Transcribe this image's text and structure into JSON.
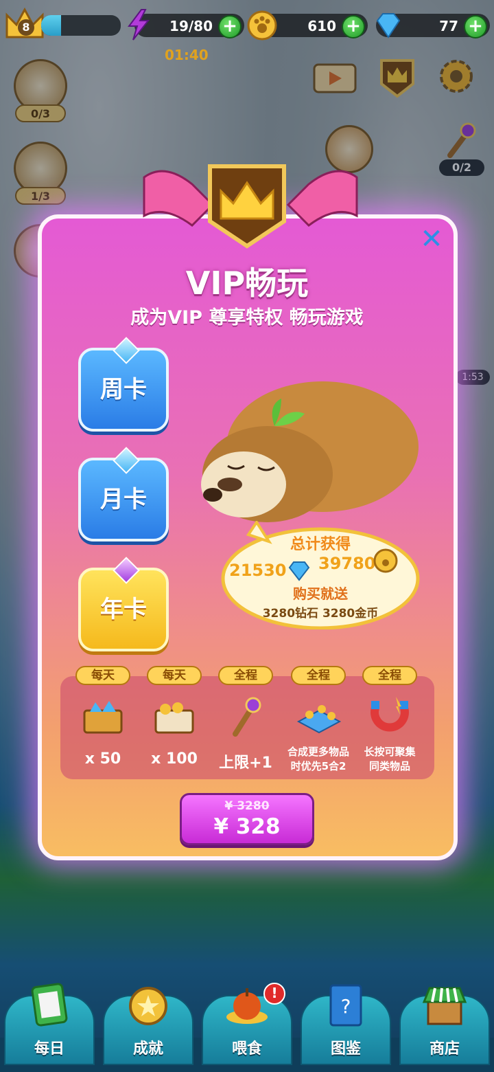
{
  "hud": {
    "level": "8",
    "xp_progress": 0.25,
    "energy_value": "19/80",
    "energy_timer": "01:40",
    "coins_value": "610",
    "gems_value": "77",
    "plus_label": "+"
  },
  "side": {
    "left_1_count": "0/3",
    "left_2_count": "1/3",
    "wand_count": "0/2",
    "right_timer": "1:53"
  },
  "modal": {
    "title": "VIP畅玩",
    "subtitle": "成为VIP 尊享特权 畅玩游戏",
    "close_label": "✕",
    "cards": [
      {
        "label": "周卡"
      },
      {
        "label": "月卡"
      },
      {
        "label": "年卡"
      }
    ],
    "bubble": {
      "total_label": "总计获得",
      "gems_total": "21530",
      "coins_total": "39780",
      "buy_bonus_label": "购买就送",
      "buy_bonus_detail": "3280钻石 3280金币"
    },
    "perks": [
      {
        "tag": "每天",
        "label": "x 50",
        "icon": "gem-chest-icon"
      },
      {
        "tag": "每天",
        "label": "x 100",
        "icon": "coin-chest-icon"
      },
      {
        "tag": "全程",
        "label": "上限+1",
        "icon": "magic-wand-icon"
      },
      {
        "tag": "全程",
        "label": "合成更多物品\n时优先5合2",
        "icon": "merge-tiles-icon"
      },
      {
        "tag": "全程",
        "label": "长按可聚集\n同类物品",
        "icon": "magnet-icon"
      }
    ],
    "price_original": "¥ 3280",
    "price_current": "¥ 328"
  },
  "nav": [
    {
      "label": "每日",
      "icon": "daily-tasks-icon"
    },
    {
      "label": "成就",
      "icon": "achievement-medal-icon"
    },
    {
      "label": "喂食",
      "icon": "feed-apple-icon"
    },
    {
      "label": "图鉴",
      "icon": "collection-book-icon"
    },
    {
      "label": "商店",
      "icon": "shop-stall-icon"
    }
  ],
  "colors": {
    "modal_top": "#e45ad4",
    "modal_bottom": "#f8bd62",
    "buy_button": "#d83de6",
    "card_blue": "#3b95f0",
    "card_gold": "#f5c52a"
  }
}
